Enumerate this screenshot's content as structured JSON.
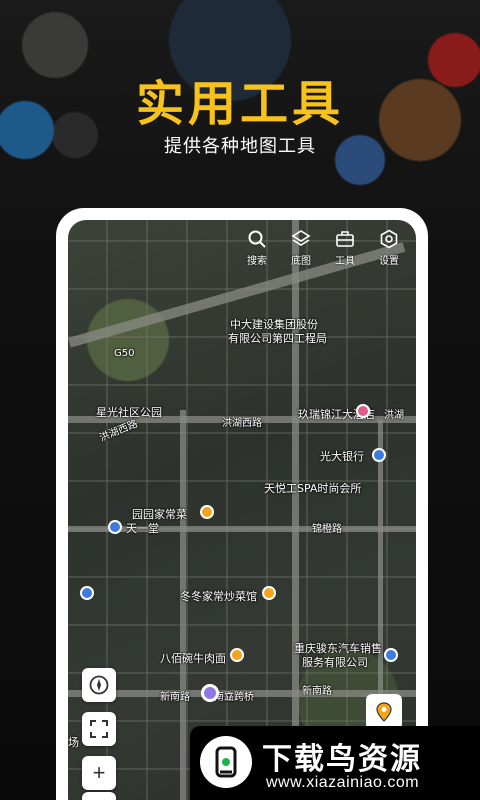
{
  "hero": {
    "title": "实用工具",
    "subtitle": "提供各种地图工具"
  },
  "toolbar": [
    {
      "label": "搜索",
      "icon": "search-icon"
    },
    {
      "label": "底图",
      "icon": "layers-icon"
    },
    {
      "label": "工具",
      "icon": "toolbox-icon"
    },
    {
      "label": "设置",
      "icon": "settings-icon"
    }
  ],
  "map_labels": {
    "road_g50": "G50",
    "company": "中大建设集团股份",
    "company2": "有限公司第四工程局",
    "community_park": "星光社区公园",
    "honghu_west1": "洪湖西路",
    "honghu_west2": "洪湖西路",
    "honghu_west3": "洪湖西路",
    "hotel": "玖瑞锦江大酒店",
    "honghu_road_right": "洪湖",
    "bank": "光大银行",
    "spa": "天悦工SPA时尚会所",
    "garden_restaurant": "园园家常菜",
    "tianyi": "天一堂",
    "jinxiang_road": "锦橙路",
    "dongdong": "冬冬家常炒菜馆",
    "babai": "八佰碗牛肉面",
    "auto_service_1": "重庆骏东汽车销售",
    "auto_service_2": "服务有限公司",
    "xinnan_road_1": "新南路",
    "xinnan_road_2": "新南路",
    "xinnan_road_3": "新南路",
    "bridge": "立跨桥",
    "chang": "场"
  },
  "controls": {
    "zoom_in": "+",
    "zoom_out": "−"
  },
  "watermark": {
    "title": "下载鸟资源",
    "url": "www.xiazainiao.com"
  },
  "colors": {
    "accent": "#f7c21a",
    "poi_yellow": "#f2a41c",
    "poi_blue": "#3c7be0",
    "user_dot": "#8f77e6"
  }
}
